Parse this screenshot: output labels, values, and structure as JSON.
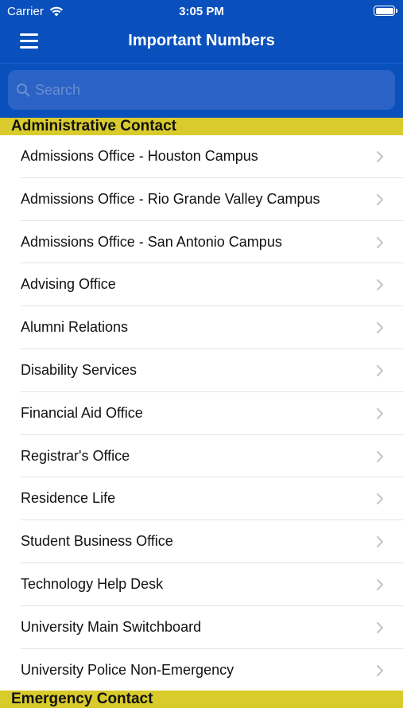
{
  "status_bar": {
    "carrier": "Carrier",
    "time": "3:05 PM",
    "icons": [
      "wifi-icon",
      "battery-icon"
    ]
  },
  "nav": {
    "title": "Important Numbers",
    "menu_icon": "hamburger-menu-icon"
  },
  "search": {
    "placeholder": "Search",
    "value": "",
    "icon": "search-icon"
  },
  "colors": {
    "header_blue": "#0a50bd",
    "section_yellow": "#d9cb2c",
    "search_field": "#2a62c6"
  },
  "sections": [
    {
      "title": "Administrative Contact",
      "items": [
        {
          "label": "Admissions Office - Houston Campus"
        },
        {
          "label": "Admissions Office - Rio Grande Valley Campus"
        },
        {
          "label": "Admissions Office - San Antonio Campus"
        },
        {
          "label": "Advising Office"
        },
        {
          "label": "Alumni Relations"
        },
        {
          "label": "Disability Services"
        },
        {
          "label": "Financial Aid Office"
        },
        {
          "label": "Registrar's Office"
        },
        {
          "label": "Residence Life"
        },
        {
          "label": "Student Business Office"
        },
        {
          "label": "Technology Help Desk"
        },
        {
          "label": "University Main Switchboard"
        },
        {
          "label": "University Police Non-Emergency"
        }
      ]
    },
    {
      "title": "Emergency Contact",
      "items": []
    }
  ]
}
